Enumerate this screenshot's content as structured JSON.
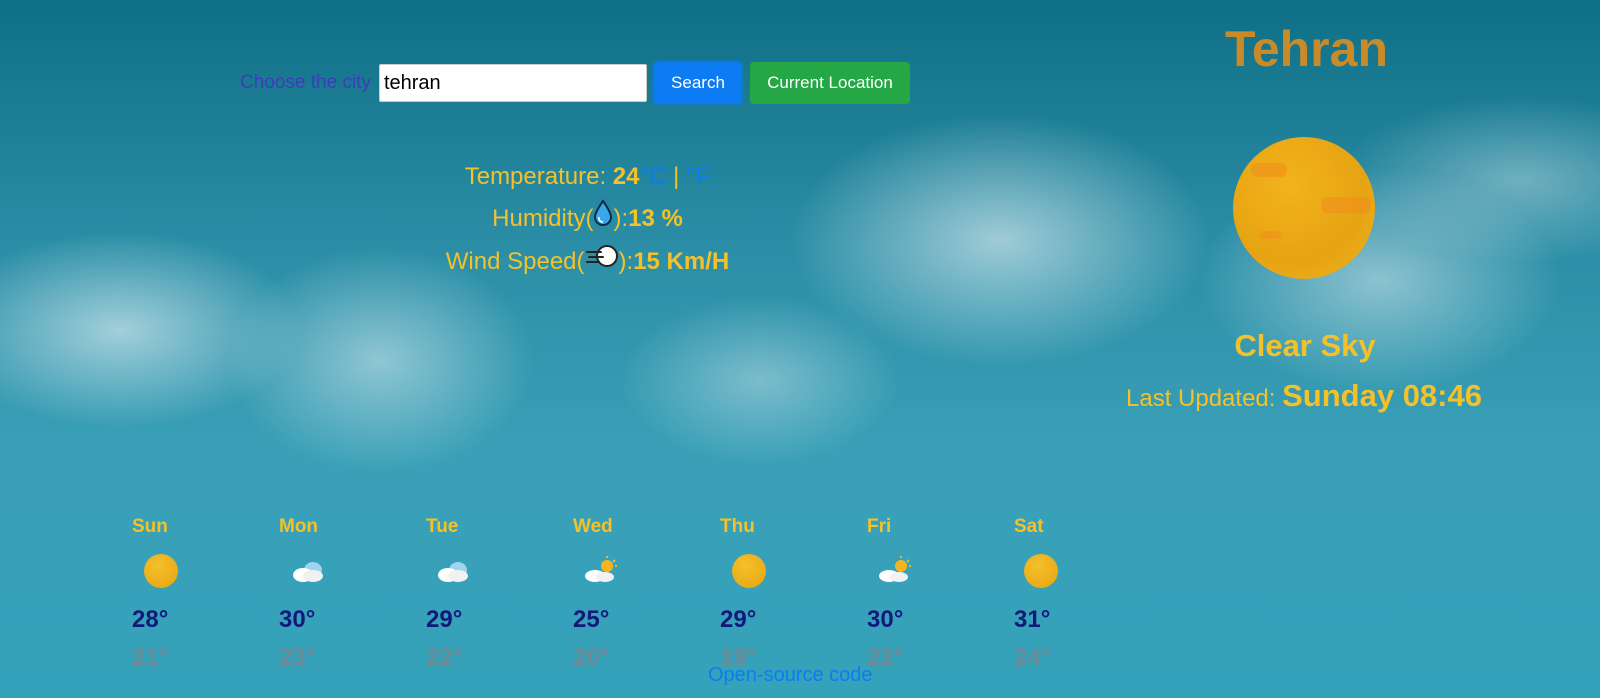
{
  "search": {
    "label": "Choose the city",
    "value": "tehran",
    "search_label": "Search",
    "location_label": "Current Location"
  },
  "details": {
    "temp_label": "Temperature: ",
    "temp_value": "24",
    "unit_c": "°C",
    "unit_sep": " | ",
    "unit_f": "°F",
    "humidity_label_pre": "Humidity(",
    "humidity_label_post": "):",
    "humidity_value": "13 %",
    "wind_label_pre": "Wind Speed(",
    "wind_label_post": "):",
    "wind_value": "15 Km/H"
  },
  "current": {
    "city": "Tehran",
    "condition": "Clear Sky",
    "updated_label": "Last Updated: ",
    "updated_value": "Sunday 08:46",
    "icon": "sun-icon"
  },
  "forecast": [
    {
      "day": "Sun",
      "icon": "sun-icon",
      "high": "28°",
      "low": "21°"
    },
    {
      "day": "Mon",
      "icon": "cloud-icon",
      "high": "30°",
      "low": "23°"
    },
    {
      "day": "Tue",
      "icon": "cloud-icon",
      "high": "29°",
      "low": "22°"
    },
    {
      "day": "Wed",
      "icon": "partly-cloudy-icon",
      "high": "25°",
      "low": "20°"
    },
    {
      "day": "Thu",
      "icon": "sun-icon",
      "high": "29°",
      "low": "19°"
    },
    {
      "day": "Fri",
      "icon": "partly-cloudy-icon",
      "high": "30°",
      "low": "22°"
    },
    {
      "day": "Sat",
      "icon": "sun-icon",
      "high": "31°",
      "low": "24°"
    }
  ],
  "footer": {
    "link": "Open-source code"
  },
  "colors": {
    "accent_yellow": "#f5c12b",
    "link_blue": "#0d7bf2",
    "high_temp": "#13197a",
    "low_temp": "#6f8a95"
  }
}
